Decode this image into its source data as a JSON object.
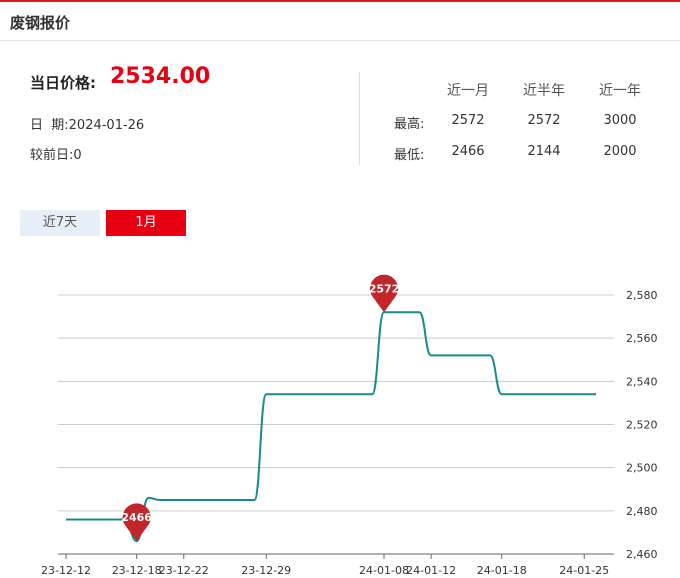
{
  "header": {
    "title": "废钢报价"
  },
  "summary": {
    "price_label": "当日价格:",
    "price_value": "2534.00",
    "date_label": "日  期:",
    "date_value": "2024-01-26",
    "change_label": "较前日:",
    "change_value": "0"
  },
  "stats": {
    "columns": [
      "近一月",
      "近半年",
      "近一年"
    ],
    "rows": [
      {
        "label": "最高:",
        "values": [
          "2572",
          "2572",
          "3000"
        ]
      },
      {
        "label": "最低:",
        "values": [
          "2466",
          "2144",
          "2000"
        ]
      }
    ]
  },
  "tabs": [
    {
      "label": "近7天",
      "active": false
    },
    {
      "label": "1月",
      "active": true
    }
  ],
  "colors": {
    "accent": "#e60012",
    "line": "#1a8a8a",
    "marker": "#c0262b",
    "tab_inactive": "#e6eef8"
  },
  "chart_data": {
    "type": "line",
    "x": [
      "23-12-12",
      "23-12-13",
      "23-12-14",
      "23-12-15",
      "23-12-16",
      "23-12-17",
      "23-12-18",
      "23-12-19",
      "23-12-20",
      "23-12-21",
      "23-12-22",
      "23-12-23",
      "23-12-24",
      "23-12-25",
      "23-12-26",
      "23-12-27",
      "23-12-28",
      "23-12-29",
      "23-12-30",
      "23-12-31",
      "24-01-01",
      "24-01-02",
      "24-01-03",
      "24-01-04",
      "24-01-05",
      "24-01-06",
      "24-01-07",
      "24-01-08",
      "24-01-09",
      "24-01-10",
      "24-01-11",
      "24-01-12",
      "24-01-13",
      "24-01-14",
      "24-01-15",
      "24-01-16",
      "24-01-17",
      "24-01-18",
      "24-01-19",
      "24-01-20",
      "24-01-21",
      "24-01-22",
      "24-01-23",
      "24-01-24",
      "24-01-25",
      "24-01-26"
    ],
    "y": [
      2476,
      2476,
      2476,
      2476,
      2476,
      2476,
      2466,
      2486,
      2485,
      2485,
      2485,
      2485,
      2485,
      2485,
      2485,
      2485,
      2485,
      2534,
      2534,
      2534,
      2534,
      2534,
      2534,
      2534,
      2534,
      2534,
      2534,
      2572,
      2572,
      2572,
      2572,
      2552,
      2552,
      2552,
      2552,
      2552,
      2552,
      2534,
      2534,
      2534,
      2534,
      2534,
      2534,
      2534,
      2534,
      2534
    ],
    "xticks": [
      "23-12-12",
      "23-12-18",
      "23-12-22",
      "23-12-29",
      "24-01-08",
      "24-01-12",
      "24-01-18",
      "24-01-25"
    ],
    "ylim": [
      2460,
      2580
    ],
    "yticks": [
      "2,460",
      "2,480",
      "2,500",
      "2,520",
      "2,540",
      "2,560",
      "2,580"
    ],
    "ytick_values": [
      2460,
      2480,
      2500,
      2520,
      2540,
      2560,
      2580
    ],
    "grid": true,
    "markers": [
      {
        "label": "2572",
        "x": "24-01-08",
        "y": 2572
      },
      {
        "label": "2466",
        "x": "23-12-18",
        "y": 2466
      }
    ]
  }
}
